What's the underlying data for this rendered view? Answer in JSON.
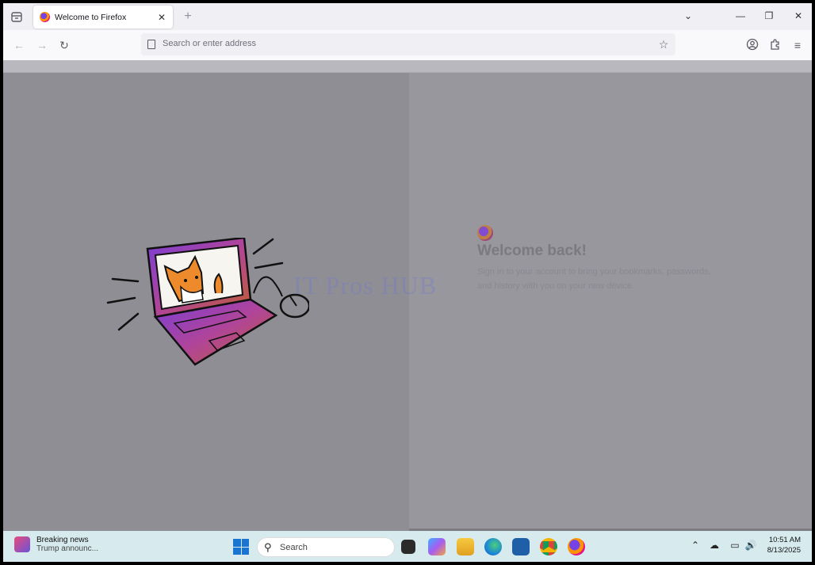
{
  "browser": {
    "tab": {
      "title": "Welcome to Firefox"
    },
    "urlbar": {
      "placeholder": "Search or enter address"
    }
  },
  "page": {
    "heading": "Welcome back!",
    "body_line1": "Sign in to your account to bring your bookmarks, passwords,",
    "body_line2": "and history with you on your new device.",
    "watermark": "IT Pros HUB"
  },
  "taskbar": {
    "news": {
      "headline": "Breaking news",
      "sub": "Trump announc..."
    },
    "search_label": "Search",
    "apps": [
      "task-view-icon",
      "copilot-icon",
      "file-explorer-icon",
      "edge-icon",
      "store-icon",
      "chrome-icon",
      "firefox-icon"
    ],
    "clock": {
      "time": "10:51 AM",
      "date": "8/13/2025"
    }
  },
  "colors": {
    "accent": "#1a75d2",
    "firefox_purple": "#7542e5",
    "firefox_orange": "#ff9400"
  }
}
